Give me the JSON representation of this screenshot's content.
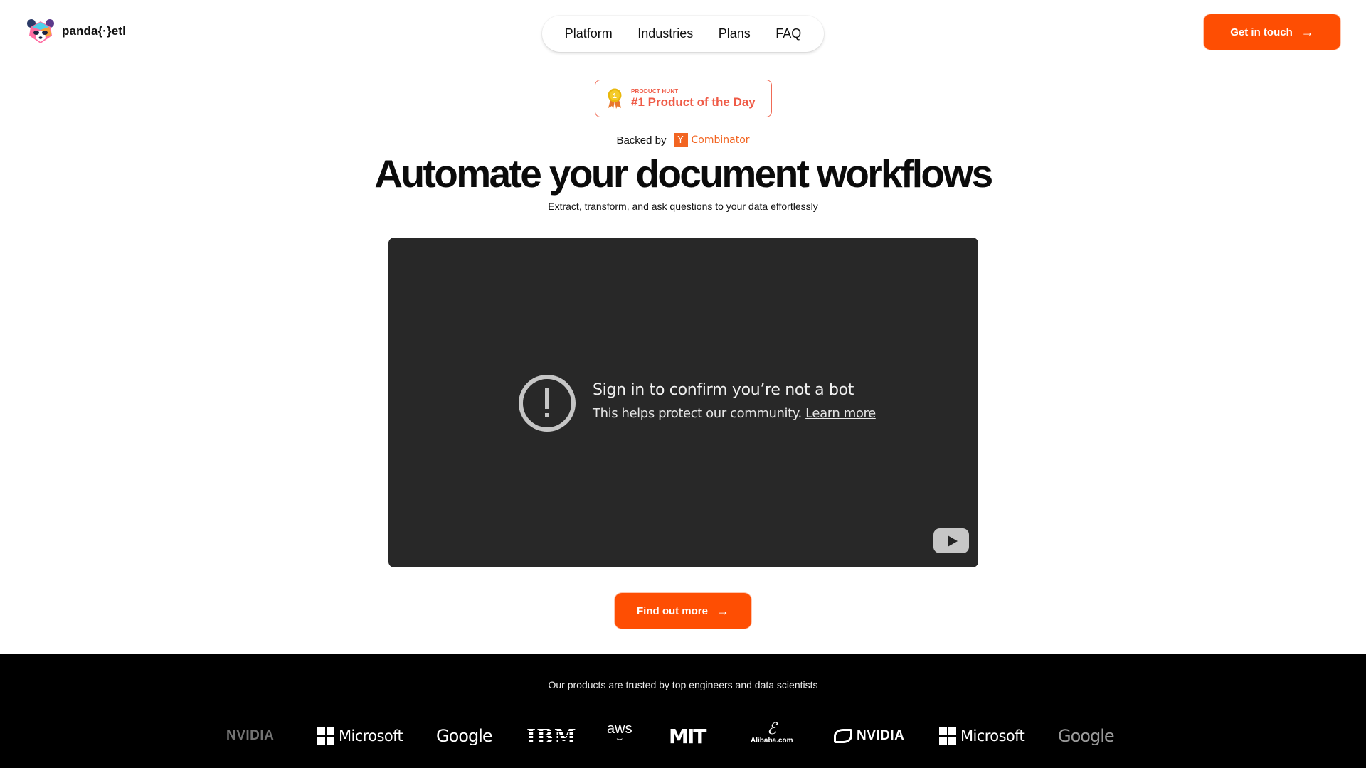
{
  "header": {
    "logo_text": "panda{·}etl",
    "nav": [
      {
        "label": "Platform"
      },
      {
        "label": "Industries"
      },
      {
        "label": "Plans"
      },
      {
        "label": "FAQ"
      }
    ],
    "cta_label": "Get in touch",
    "cta_icon": "arrow-right-icon"
  },
  "badge": {
    "overline": "PRODUCT HUNT",
    "title": "#1 Product of the Day",
    "medal_number": "1"
  },
  "backed": {
    "label": "Backed by",
    "yc_letter": "Y",
    "yc_name": "Combinator"
  },
  "hero": {
    "headline": "Automate your document workflows",
    "subline": "Extract, transform, and ask questions to your data effortlessly"
  },
  "video": {
    "title": "Sign in to confirm you’re not a bot",
    "subtitle": "This helps protect our community.",
    "link_label": "Learn more"
  },
  "cta_more": {
    "label": "Find out more"
  },
  "footer": {
    "text": "Our products are trusted by top engineers and data scientists",
    "logos": [
      "NVIDIA",
      "Microsoft",
      "Google",
      "IBM",
      "aws",
      "MIT",
      "Alibaba.com",
      "NVIDIA",
      "Microsoft",
      "Google"
    ]
  },
  "colors": {
    "accent": "#fe4e03",
    "badge": "#ef5b47",
    "yc": "#f26522",
    "video_bg": "#282828",
    "footer_bg": "#000000"
  }
}
